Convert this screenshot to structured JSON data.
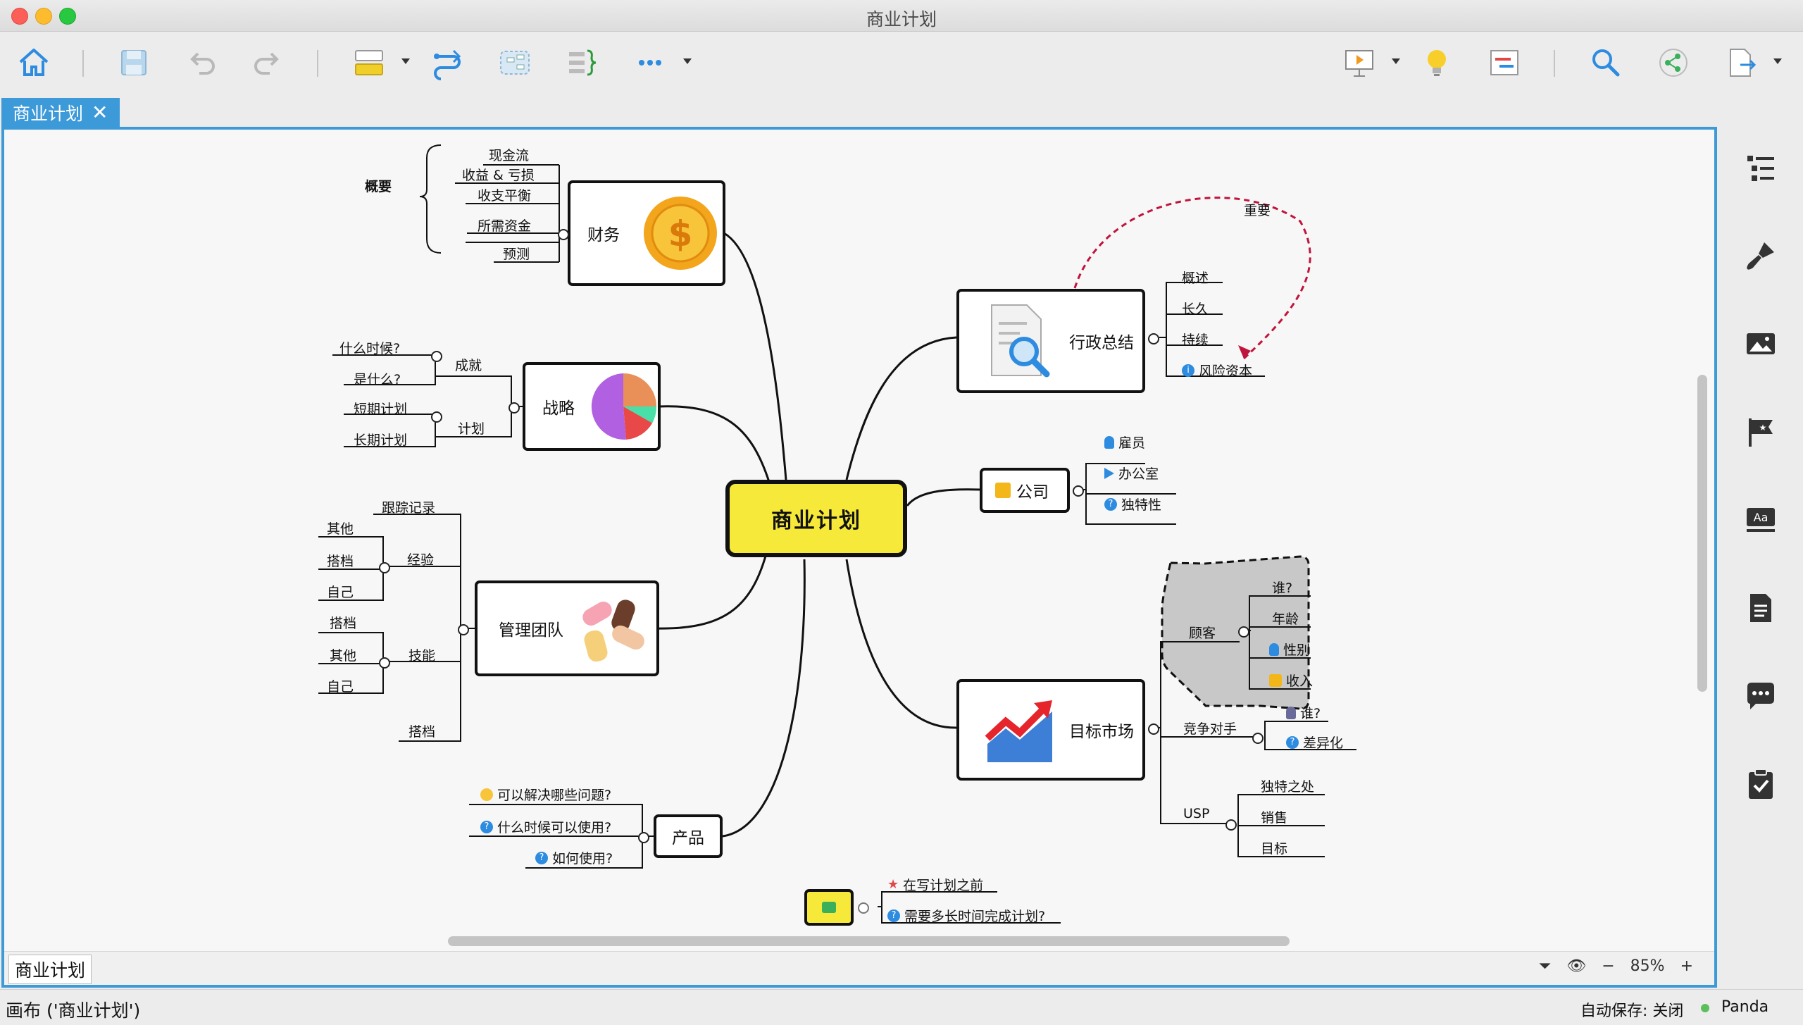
{
  "window": {
    "title": "商业计划"
  },
  "tab": {
    "label": "商业计划",
    "close": "✕"
  },
  "central": {
    "label": "商业计划"
  },
  "branches": {
    "finance": {
      "label": "财务",
      "children": [
        "现金流",
        "收益 & 亏损",
        "收支平衡",
        "所需资金",
        "预测"
      ],
      "summary": "概要"
    },
    "strategy": {
      "label": "战略",
      "groups": [
        {
          "label": "成就",
          "children": [
            "什么时候?",
            "是什么?"
          ]
        },
        {
          "label": "计划",
          "children": [
            "短期计划",
            "长期计划"
          ]
        }
      ]
    },
    "team": {
      "label": "管理团队",
      "track": "跟踪记录",
      "groups": [
        {
          "label": "经验",
          "children": [
            "其他",
            "搭档",
            "自己"
          ]
        },
        {
          "label": "技能",
          "children": [
            "搭档",
            "其他",
            "自己"
          ]
        }
      ],
      "extra": "搭档"
    },
    "product": {
      "label": "产品",
      "children": [
        "可以解决哪些问题?",
        "什么时候可以使用?",
        "如何使用?"
      ]
    },
    "exec": {
      "label": "行政总结",
      "children": [
        "概述",
        "长久",
        "持续",
        "风险资本"
      ],
      "relation": "重要"
    },
    "company": {
      "label": "公司",
      "children": [
        "雇员",
        "办公室",
        "独特性"
      ]
    },
    "market": {
      "label": "目标市场",
      "customer": {
        "label": "顾客",
        "children": [
          "谁?",
          "年龄",
          "性别",
          "收入"
        ]
      },
      "competitor": {
        "label": "竞争对手",
        "children": [
          "谁?",
          "差异化"
        ]
      },
      "usp": {
        "label": "USP",
        "children": [
          "独特之处",
          "销售",
          "目标"
        ]
      }
    },
    "floating": {
      "children": [
        "在写计划之前",
        "需要多长时间完成计划?"
      ]
    }
  },
  "canvas_footer": {
    "sheet": "商业计划",
    "zoom": "85%"
  },
  "statusbar": {
    "left": "画布 ('商业计划')",
    "autosave": "自动保存: 关闭",
    "user": "Panda"
  },
  "colors": {
    "accent": "#3d9ad8",
    "central_fill": "#f7e93a",
    "relation": "#c0143c",
    "boundary": "#c8c8c8"
  }
}
